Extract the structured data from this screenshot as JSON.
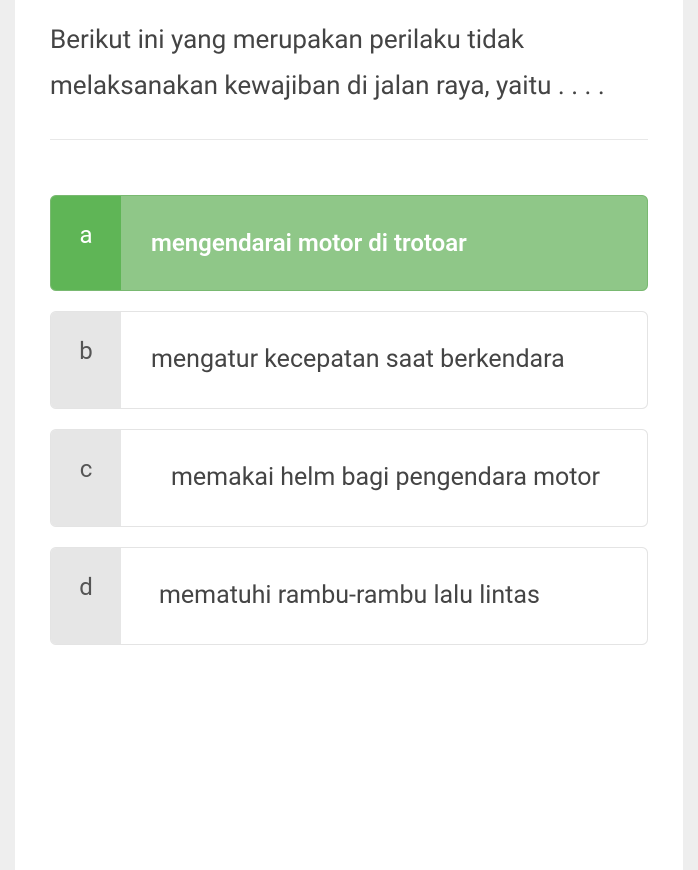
{
  "question": "Berikut ini yang merupakan perilaku tidak melaksanakan kewajiban di jalan raya, yaitu . . . .",
  "options": {
    "a": {
      "key": "a",
      "text": "mengendarai motor di trotoar",
      "selected": true
    },
    "b": {
      "key": "b",
      "text": "mengatur kecepatan saat berkendara",
      "selected": false
    },
    "c": {
      "key": "c",
      "text": "memakai helm bagi pengendara motor",
      "selected": false
    },
    "d": {
      "key": "d",
      "text": "mematuhi rambu-rambu lalu lintas",
      "selected": false
    }
  }
}
